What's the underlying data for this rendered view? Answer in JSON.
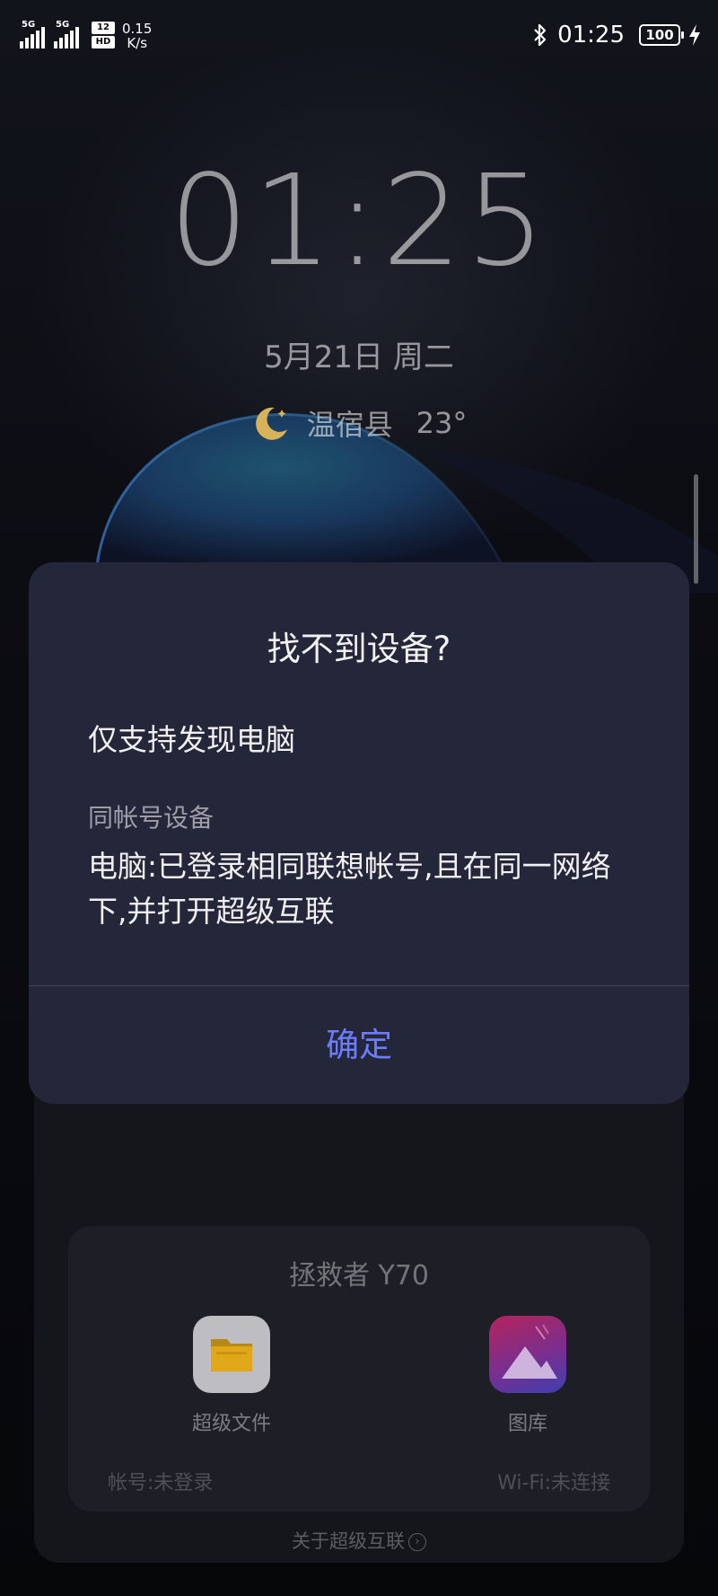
{
  "status_bar": {
    "sim1": "5G",
    "sim2": "5G",
    "hd_top": "12",
    "hd_bottom": "HD",
    "speed_value": "0.15",
    "speed_unit": "K/s",
    "time": "01:25",
    "battery": "100",
    "icons": [
      "signal-icon",
      "signal-icon",
      "hd-icon",
      "bluetooth-icon",
      "battery-icon",
      "charging-bolt-icon"
    ]
  },
  "lockscreen": {
    "clock": "01:25",
    "date": "5月21日 周二",
    "weather_icon": "moon-icon",
    "location": "温宿县",
    "temperature": "23°"
  },
  "dialog": {
    "title": "找不到设备?",
    "line1": "仅支持发现电脑",
    "subtitle": "同帐号设备",
    "body": "电脑:已登录相同联想帐号,且在同一网络下,并打开超级互联",
    "ok_label": "确定",
    "accent_color": "#6b7cff"
  },
  "device_card": {
    "title": "拯救者 Y70",
    "apps": [
      {
        "label": "超级文件",
        "icon": "folder-icon"
      },
      {
        "label": "图库",
        "icon": "gallery-icon"
      }
    ],
    "account": "帐号:未登录",
    "wifi": "Wi-Fi:未连接"
  },
  "about_link": "关于超级互联"
}
